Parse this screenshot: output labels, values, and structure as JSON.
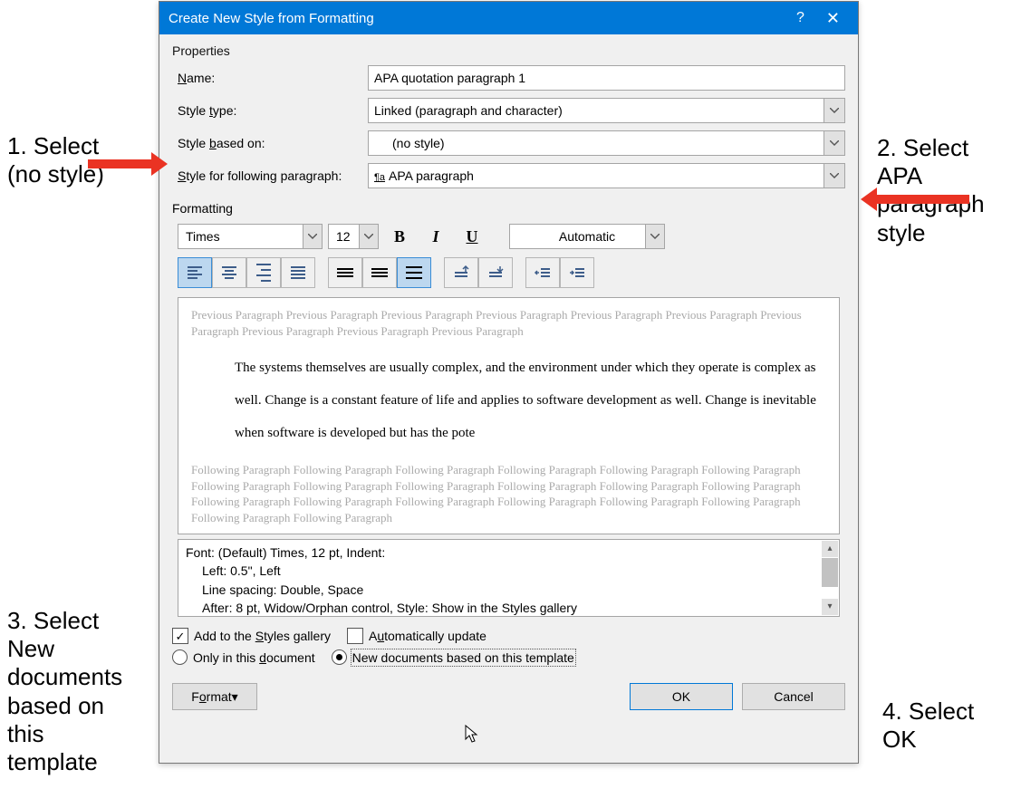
{
  "dialog": {
    "title": "Create New Style from Formatting",
    "properties_label": "Properties",
    "labels": {
      "name": "Name:",
      "style_type": "Style type:",
      "style_based_on": "Style based on:",
      "style_following": "Style for following paragraph:"
    },
    "name_value": "APA quotation paragraph 1",
    "style_type_value": "Linked (paragraph and character)",
    "style_based_on_value": "(no style)",
    "style_following_value": "APA paragraph",
    "formatting_label": "Formatting",
    "font_name": "Times",
    "font_size": "12",
    "font_color": "Automatic",
    "preview": {
      "prev": "Previous Paragraph Previous Paragraph Previous Paragraph Previous Paragraph Previous Paragraph Previous Paragraph Previous Paragraph Previous Paragraph Previous Paragraph Previous Paragraph",
      "sample": "The systems themselves are usually complex, and the environment under which they operate is complex as well. Change is a constant feature of life and applies to software development as well. Change is inevitable when software is developed but has the pote",
      "foll": "Following Paragraph Following Paragraph Following Paragraph Following Paragraph Following Paragraph Following Paragraph Following Paragraph Following Paragraph Following Paragraph Following Paragraph Following Paragraph Following Paragraph Following Paragraph Following Paragraph Following Paragraph Following Paragraph Following Paragraph Following Paragraph Following Paragraph Following Paragraph"
    },
    "style_desc_line1": "Font: (Default) Times, 12 pt, Indent:",
    "style_desc_line2": "Left:  0.5\", Left",
    "style_desc_line3": "Line spacing:  Double, Space",
    "style_desc_line4": "After:  8 pt, Widow/Orphan control, Style: Show in the Styles gallery",
    "add_to_gallery": "Add to the Styles gallery",
    "auto_update": "Automatically update",
    "only_this_doc": "Only in this document",
    "new_docs_template": "New documents based on this template",
    "format_btn": "Format",
    "ok_btn": "OK",
    "cancel_btn": "Cancel"
  },
  "annotations": {
    "a1_line1": "1. Select",
    "a1_line2": "(no style)",
    "a2_line1": "2. Select",
    "a2_line2": "APA",
    "a2_line3": "paragraph",
    "a2_line4": "style",
    "a3_line1": "3. Select",
    "a3_line2": "New",
    "a3_line3": "documents",
    "a3_line4": "based on",
    "a3_line5": "this",
    "a3_line6": "template",
    "a4_line1": "4. Select",
    "a4_line2": "OK"
  }
}
